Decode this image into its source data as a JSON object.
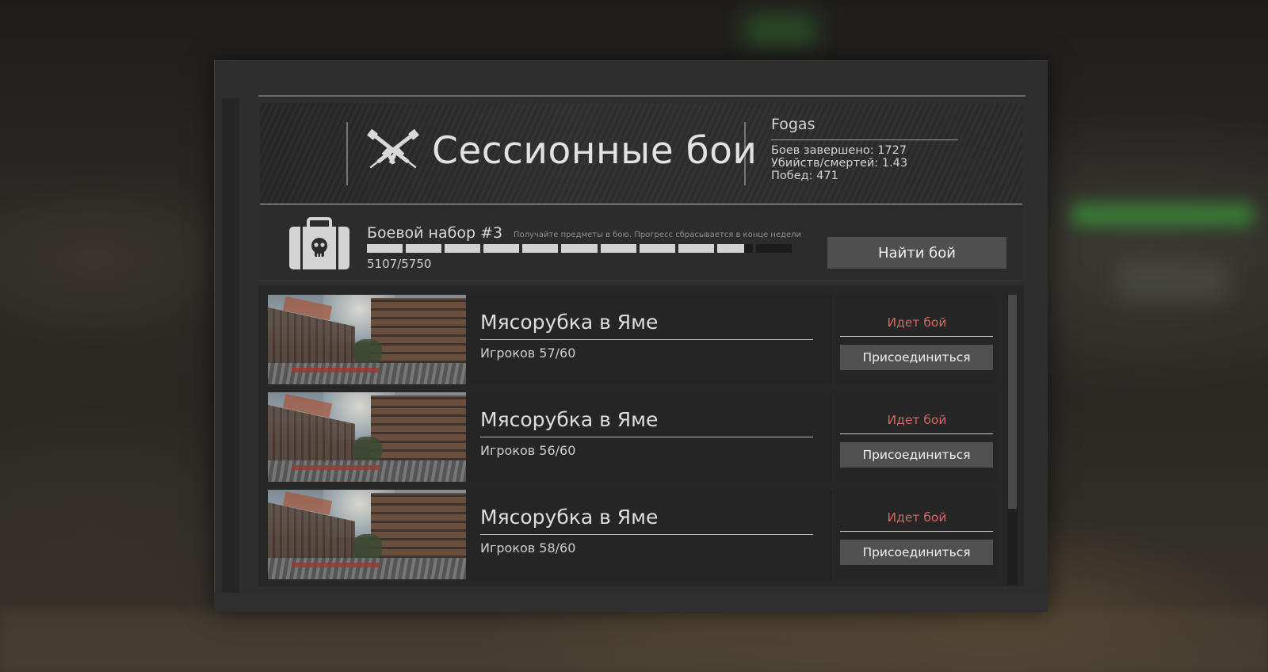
{
  "header": {
    "mode_title": "Сессионные бои",
    "mode_icon": "crossed-rifles-icon"
  },
  "player": {
    "name": "Fogas",
    "battles_label": "Боев завершено: 1727",
    "kd_label": "Убийств/смертей: 1.43",
    "wins_label": "Побед: 471"
  },
  "kit": {
    "icon": "skull-briefcase-icon",
    "title": "Боевой набор #3",
    "hint": "Получайте предметы в бою. Прогресс сбрасывается в конце недели",
    "progress_label": "5107/5750",
    "progress_current": 5107,
    "progress_max": 5750,
    "segments_total": 11,
    "find_button": "Найти бой"
  },
  "sessions": [
    {
      "map": "Мясорубка в Яме",
      "players": "Игроков 57/60",
      "status": "Идет бой",
      "join": "Присоединиться"
    },
    {
      "map": "Мясорубка в Яме",
      "players": "Игроков 56/60",
      "status": "Идет бой",
      "join": "Присоединиться"
    },
    {
      "map": "Мясорубка в Яме",
      "players": "Игроков 58/60",
      "status": "Идет бой",
      "join": "Присоединиться"
    }
  ],
  "colors": {
    "status": "#cf6b62",
    "button": "#4f4f4f",
    "progress_filled": "#d2d2d2",
    "progress_empty": "#1c1c1c"
  }
}
